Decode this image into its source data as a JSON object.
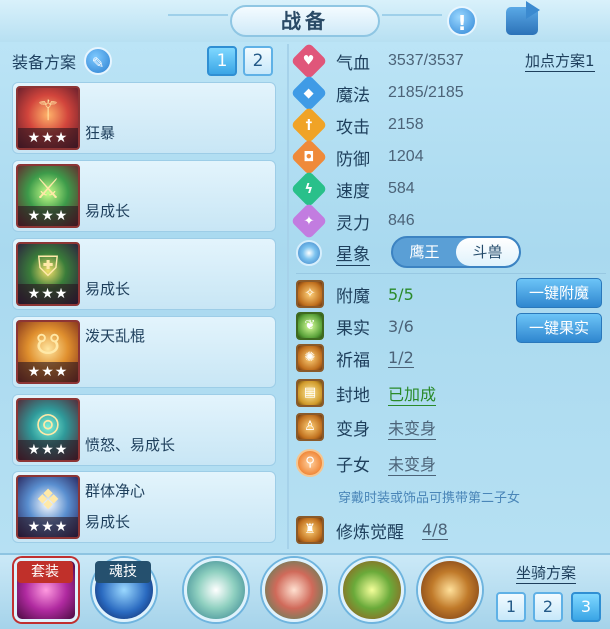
{
  "header": {
    "title": "战备",
    "info_icon": "exclamation-icon",
    "share_icon": "share-icon"
  },
  "left": {
    "title": "装备方案",
    "edit_icon": "pencil-icon",
    "plans": [
      "1",
      "2"
    ],
    "active_plan": "1",
    "equipment": [
      {
        "line1": "",
        "line2": "狂暴",
        "stars": "★★★",
        "icon": "scepter-icon"
      },
      {
        "line1": "",
        "line2": "易成长",
        "stars": "★★★",
        "icon": "spear-icon"
      },
      {
        "line1": "",
        "line2": "易成长",
        "stars": "★★★",
        "icon": "armor-icon"
      },
      {
        "line1": "泼天乱棍",
        "line2": "",
        "stars": "★★★",
        "icon": "necklace-icon"
      },
      {
        "line1": "",
        "line2": "愤怒、易成长",
        "stars": "★★★",
        "icon": "belt-icon"
      },
      {
        "line1": "群体净心",
        "line2": "易成长",
        "stars": "★★★",
        "icon": "boots-icon"
      }
    ]
  },
  "stats": {
    "add_plan": "加点方案1",
    "items": [
      {
        "label": "气血",
        "value": "3537/3537",
        "color": "#e0567a",
        "glyph": "♥"
      },
      {
        "label": "魔法",
        "value": "2185/2185",
        "color": "#3f9be6",
        "glyph": "◆"
      },
      {
        "label": "攻击",
        "value": "2158",
        "color": "#f0a326",
        "glyph": "†"
      },
      {
        "label": "防御",
        "value": "1204",
        "color": "#ef8a3a",
        "glyph": "◘"
      },
      {
        "label": "速度",
        "value": "584",
        "color": "#29c08a",
        "glyph": "ϟ"
      },
      {
        "label": "灵力",
        "value": "846",
        "color": "#c27ce0",
        "glyph": "✦"
      }
    ],
    "star_label": "星象",
    "star_options": [
      "鹰王",
      "斗兽"
    ],
    "star_selected": "斗兽"
  },
  "options": {
    "items": [
      {
        "label": "附魔",
        "value": "5/5",
        "style": "green nou",
        "icon": "enchant-icon"
      },
      {
        "label": "果实",
        "value": "3/6",
        "style": "nou",
        "icon": "fruit-icon"
      },
      {
        "label": "祈福",
        "value": "1/2",
        "style": "",
        "icon": "pray-icon"
      },
      {
        "label": "封地",
        "value": "已加成",
        "style": "green",
        "icon": "fief-icon"
      },
      {
        "label": "变身",
        "value": "未变身",
        "style": "",
        "icon": "transform-icon"
      },
      {
        "label": "子女",
        "value": "未变身",
        "style": "",
        "icon": "child-icon"
      }
    ],
    "btn_enchant": "一键附魔",
    "btn_fruit": "一键果实",
    "note": "穿戴时装或饰品可携带第二子女",
    "practice_label": "修炼觉醒",
    "practice_value": "4/8"
  },
  "bottom": {
    "tag_outfit": "套装",
    "tag_soul": "魂技",
    "mount_title": "坐骑方案",
    "mount_plans": [
      "1",
      "2",
      "3"
    ],
    "mount_active": "3",
    "skills": [
      "outfit-skill-icon",
      "soul-skill-icon",
      "skill-1-icon",
      "skill-2-icon",
      "skill-3-icon",
      "skill-4-icon"
    ]
  }
}
